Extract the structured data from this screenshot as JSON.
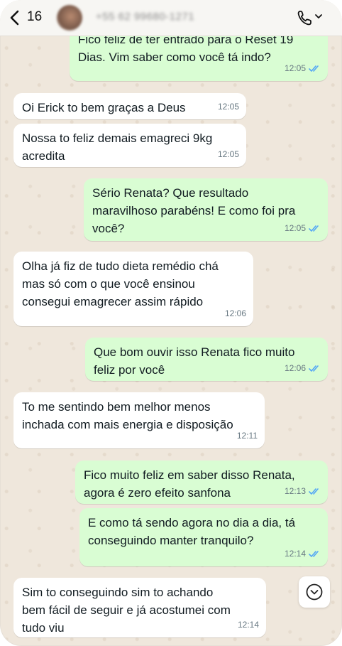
{
  "header": {
    "back_count": "16",
    "contact_number": "+55 62 99680-1271"
  },
  "colors": {
    "incoming_bubble": "#ffffff",
    "outgoing_bubble": "#d9fdd3",
    "read_check": "#53a6f5",
    "chat_background": "#efe7dc"
  },
  "messages": [
    {
      "direction": "outgoing",
      "text": "Fico feliz de ter entrado para o Reset 19\nDias. Vim saber como você tá indo?",
      "time": "12:05",
      "read": true
    },
    {
      "direction": "incoming",
      "text": "Oi Erick to bem graças a Deus",
      "time": "12:05"
    },
    {
      "direction": "incoming",
      "text": "Nossa to feliz demais emagreci 9kg\nacredita",
      "time": "12:05"
    },
    {
      "direction": "outgoing",
      "text": "Sério Renata? Que resultado\nmaravilhoso parabéns! E como foi pra\nvocê?",
      "time": "12:05",
      "read": true
    },
    {
      "direction": "incoming",
      "text": "Olha já fiz de tudo dieta remédio chá\nmas só com o que você ensinou\nconsegui emagrecer assim rápido",
      "time": "12:06"
    },
    {
      "direction": "outgoing",
      "text": "Que bom ouvir isso Renata fico muito\nfeliz por você",
      "time": "12:06",
      "read": true
    },
    {
      "direction": "incoming",
      "text": "To me sentindo bem melhor menos\ninchada com mais energia e disposição",
      "time": "12:11"
    },
    {
      "direction": "outgoing",
      "text": "Fico muito feliz em saber disso Renata,\nagora é zero efeito sanfona",
      "time": "12:13",
      "read": true
    },
    {
      "direction": "outgoing",
      "text": "E como tá sendo agora no dia a dia, tá\nconseguindo manter tranquilo?",
      "time": "12:14",
      "read": true
    },
    {
      "direction": "incoming",
      "text": "Sim to conseguindo sim to achando\nbem fácil de seguir e já acostumei com\ntudo viu",
      "time": "12:14"
    }
  ]
}
